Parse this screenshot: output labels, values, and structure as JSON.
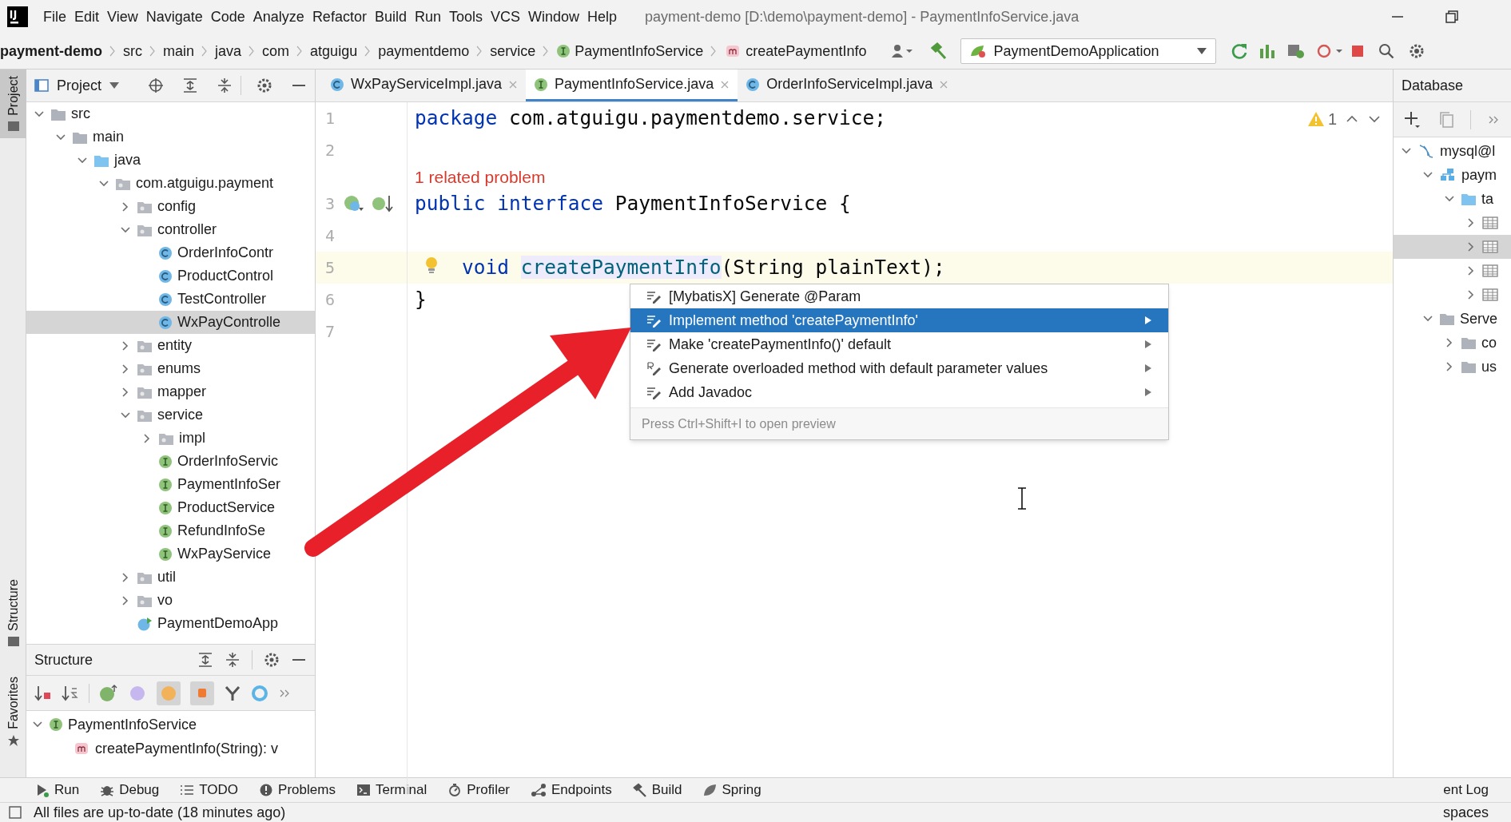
{
  "menu": [
    "File",
    "Edit",
    "View",
    "Navigate",
    "Code",
    "Analyze",
    "Refactor",
    "Build",
    "Run",
    "Tools",
    "VCS",
    "Window",
    "Help"
  ],
  "window": {
    "title": "payment-demo [D:\\demo\\payment-demo] - PaymentInfoService.java"
  },
  "breadcrumbs": [
    {
      "text": "payment-demo",
      "kind": "project"
    },
    {
      "text": "src",
      "kind": "dir"
    },
    {
      "text": "main",
      "kind": "dir"
    },
    {
      "text": "java",
      "kind": "dir"
    },
    {
      "text": "com",
      "kind": "dir"
    },
    {
      "text": "atguigu",
      "kind": "dir"
    },
    {
      "text": "paymentdemo",
      "kind": "dir"
    },
    {
      "text": "service",
      "kind": "dir"
    },
    {
      "text": "PaymentInfoService",
      "kind": "interface"
    },
    {
      "text": "createPaymentInfo",
      "kind": "method"
    }
  ],
  "run_config": "PaymentDemoApplication",
  "side_tabs": [
    {
      "label": "Project",
      "selected": true
    },
    {
      "label": "Structure",
      "selected": false
    },
    {
      "label": "Favorites",
      "selected": false
    }
  ],
  "project_panel": {
    "title": "Project",
    "tree": [
      {
        "label": "src",
        "kind": "folder",
        "expanded": true,
        "selected": false,
        "children": [
          {
            "label": "main",
            "kind": "folder",
            "expanded": true,
            "selected": false,
            "children": [
              {
                "label": "java",
                "kind": "source",
                "expanded": true,
                "selected": false,
                "children": [
                  {
                    "label": "com.atguigu.payment",
                    "kind": "package",
                    "expanded": true,
                    "selected": false,
                    "children": [
                      {
                        "label": "config",
                        "kind": "package",
                        "expanded": false,
                        "selected": false
                      },
                      {
                        "label": "controller",
                        "kind": "package",
                        "expanded": true,
                        "selected": false,
                        "children": [
                          {
                            "label": "OrderInfoContr",
                            "kind": "class",
                            "selected": false
                          },
                          {
                            "label": "ProductControl",
                            "kind": "class",
                            "selected": false
                          },
                          {
                            "label": "TestController",
                            "kind": "class",
                            "selected": false
                          },
                          {
                            "label": "WxPayControlle",
                            "kind": "class",
                            "selected": true
                          }
                        ]
                      },
                      {
                        "label": "entity",
                        "kind": "package",
                        "expanded": false,
                        "selected": false
                      },
                      {
                        "label": "enums",
                        "kind": "package",
                        "expanded": false,
                        "selected": false
                      },
                      {
                        "label": "mapper",
                        "kind": "package",
                        "expanded": false,
                        "selected": false
                      },
                      {
                        "label": "service",
                        "kind": "package",
                        "expanded": true,
                        "selected": false,
                        "children": [
                          {
                            "label": "impl",
                            "kind": "package",
                            "expanded": false,
                            "selected": false
                          },
                          {
                            "label": "OrderInfoServic",
                            "kind": "interface",
                            "selected": false
                          },
                          {
                            "label": "PaymentInfoSer",
                            "kind": "interface",
                            "selected": false
                          },
                          {
                            "label": "ProductService",
                            "kind": "interface",
                            "selected": false
                          },
                          {
                            "label": "RefundInfoSe",
                            "kind": "interface",
                            "selected": false
                          },
                          {
                            "label": "WxPayService",
                            "kind": "interface",
                            "selected": false
                          }
                        ]
                      },
                      {
                        "label": "util",
                        "kind": "package",
                        "expanded": false,
                        "selected": false
                      },
                      {
                        "label": "vo",
                        "kind": "package",
                        "expanded": false,
                        "selected": false
                      },
                      {
                        "label": "PaymentDemoApp",
                        "kind": "app",
                        "selected": false
                      }
                    ]
                  }
                ]
              }
            ]
          }
        ]
      }
    ]
  },
  "structure_panel": {
    "title": "Structure",
    "tree": [
      {
        "label": "PaymentInfoService",
        "kind": "interface",
        "expanded": true,
        "selected": false,
        "children": [
          {
            "label": "createPaymentInfo(String): v",
            "kind": "method",
            "selected": false
          }
        ]
      }
    ]
  },
  "editor_tabs": [
    {
      "label": "WxPayServiceImpl.java",
      "kind": "class",
      "selected": false
    },
    {
      "label": "PaymentInfoService.java",
      "kind": "interface",
      "selected": true
    },
    {
      "label": "OrderInfoServiceImpl.java",
      "kind": "class",
      "selected": false
    }
  ],
  "editor": {
    "warnings": "1",
    "lines": [
      {
        "kind": "code",
        "number": "1",
        "current": false,
        "tokens": [
          {
            "text": "package ",
            "kind": "keyword"
          },
          {
            "text": "com.atguigu.paymentdemo.service;",
            "kind": "plain"
          }
        ]
      },
      {
        "kind": "code",
        "number": "2",
        "current": false
      },
      {
        "kind": "hint",
        "text": "1 related problem"
      },
      {
        "kind": "code",
        "number": "3",
        "current": false,
        "gutter_marks": true,
        "tokens": [
          {
            "text": "public interface ",
            "kind": "keyword"
          },
          {
            "text": "PaymentInfoService {",
            "kind": "plain"
          }
        ]
      },
      {
        "kind": "code",
        "number": "4",
        "current": false
      },
      {
        "kind": "code",
        "number": "5",
        "current": true,
        "bulb": true,
        "tokens": [
          {
            "text": "    void ",
            "kind": "keyword"
          },
          {
            "text": "createPaymentInfo",
            "kind": "highlight"
          },
          {
            "text": "(String plainText);",
            "kind": "plain"
          }
        ]
      },
      {
        "kind": "code",
        "number": "6",
        "current": false,
        "tokens": [
          {
            "text": "}",
            "kind": "plain"
          }
        ]
      },
      {
        "kind": "code",
        "number": "7",
        "current": false
      }
    ]
  },
  "popup": {
    "items": [
      {
        "label": "[MybatisX] Generate @Param",
        "kind": "intention",
        "selected": false,
        "submenu": false
      },
      {
        "label": "Implement method 'createPaymentInfo'",
        "kind": "intention",
        "selected": true,
        "submenu": true
      },
      {
        "label": "Make 'createPaymentInfo()' default",
        "kind": "intention",
        "selected": false,
        "submenu": true
      },
      {
        "label": "Generate overloaded method with default parameter values",
        "kind": "overload",
        "selected": false,
        "submenu": true
      },
      {
        "label": "Add Javadoc",
        "kind": "intention",
        "selected": false,
        "submenu": true
      }
    ],
    "footer": "Press Ctrl+Shift+I to open preview"
  },
  "database_panel": {
    "title": "Database",
    "tree": [
      {
        "label": "mysql@l",
        "kind": "datasource",
        "expanded": true,
        "selected": false,
        "children": [
          {
            "label": "paym",
            "kind": "schema",
            "expanded": true,
            "selected": false,
            "children": [
              {
                "label": "ta",
                "kind": "source",
                "expanded": true,
                "selected": false,
                "children": [
                  {
                    "kind": "table",
                    "expanded": false,
                    "selected": false
                  },
                  {
                    "kind": "table",
                    "expanded": false,
                    "selected": true
                  },
                  {
                    "kind": "table",
                    "expanded": false,
                    "selected": false
                  },
                  {
                    "kind": "table",
                    "expanded": false,
                    "selected": false
                  }
                ]
              }
            ]
          },
          {
            "label": "Serve",
            "kind": "folder",
            "expanded": true,
            "selected": false,
            "children": [
              {
                "label": "co",
                "kind": "folder",
                "expanded": false,
                "selected": false
              },
              {
                "label": "us",
                "kind": "folder",
                "expanded": false,
                "selected": false
              }
            ]
          }
        ]
      }
    ]
  },
  "tool_windows": [
    {
      "label": "Run",
      "kind": "run"
    },
    {
      "label": "Debug",
      "kind": "debug"
    },
    {
      "label": "TODO",
      "kind": "todo"
    },
    {
      "label": "Problems",
      "kind": "problems"
    },
    {
      "label": "Terminal",
      "kind": "terminal"
    },
    {
      "label": "Profiler",
      "kind": "profiler"
    },
    {
      "label": "Endpoints",
      "kind": "endpoints"
    },
    {
      "label": "Build",
      "kind": "build"
    },
    {
      "label": "Spring",
      "kind": "spring"
    }
  ],
  "tool_windows_right": "ent Log",
  "status_bar": {
    "text": "All files are up-to-date (18 minutes ago)",
    "right": "spaces"
  }
}
